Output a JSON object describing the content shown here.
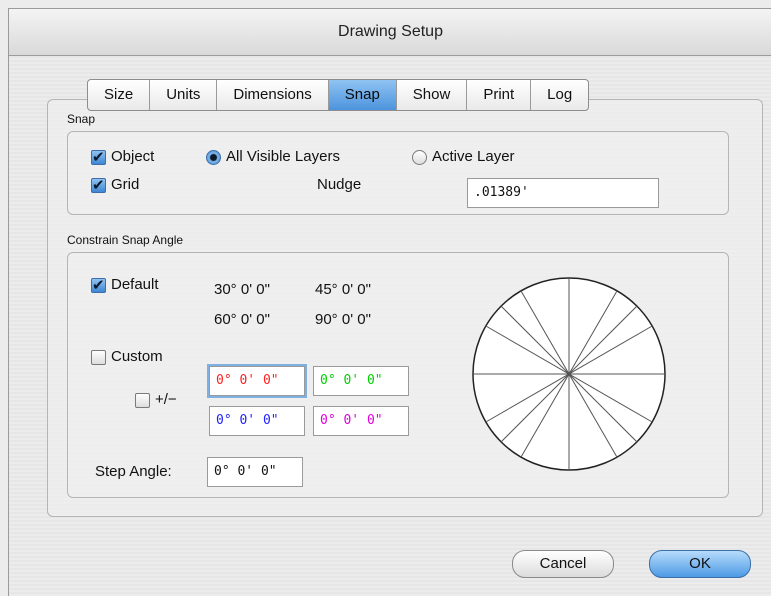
{
  "window": {
    "title": "Drawing Setup"
  },
  "tabs": [
    "Size",
    "Units",
    "Dimensions",
    "Snap",
    "Show",
    "Print",
    "Log"
  ],
  "active_tab": "Snap",
  "snap": {
    "section_label": "Snap",
    "object_label": "Object",
    "object_checked": true,
    "grid_label": "Grid",
    "grid_checked": true,
    "all_visible_layers_label": "All Visible Layers",
    "active_layer_label": "Active Layer",
    "selected_layer_option": "All Visible Layers",
    "nudge_label": "Nudge",
    "nudge_value": ".01389'"
  },
  "constrain": {
    "section_label": "Constrain Snap Angle",
    "default_label": "Default",
    "default_checked": true,
    "angles": [
      "30° 0' 0\"",
      "45° 0' 0\"",
      "60° 0' 0\"",
      "90° 0' 0\""
    ],
    "custom_label": "Custom",
    "custom_checked": false,
    "plusminus_label": "+/−",
    "plusminus_checked": false,
    "custom_fields": [
      {
        "value": "0° 0' 0\"",
        "color": "#ff2020"
      },
      {
        "value": "0° 0' 0\"",
        "color": "#00d000"
      },
      {
        "value": "0° 0' 0\"",
        "color": "#2020ff"
      },
      {
        "value": "0° 0' 0\"",
        "color": "#e000e0"
      }
    ],
    "step_angle_label": "Step Angle:",
    "step_angle_value": "0° 0' 0\"",
    "snap_angles_deg": [
      30,
      45,
      60,
      90
    ]
  },
  "buttons": {
    "cancel": "Cancel",
    "ok": "OK"
  }
}
